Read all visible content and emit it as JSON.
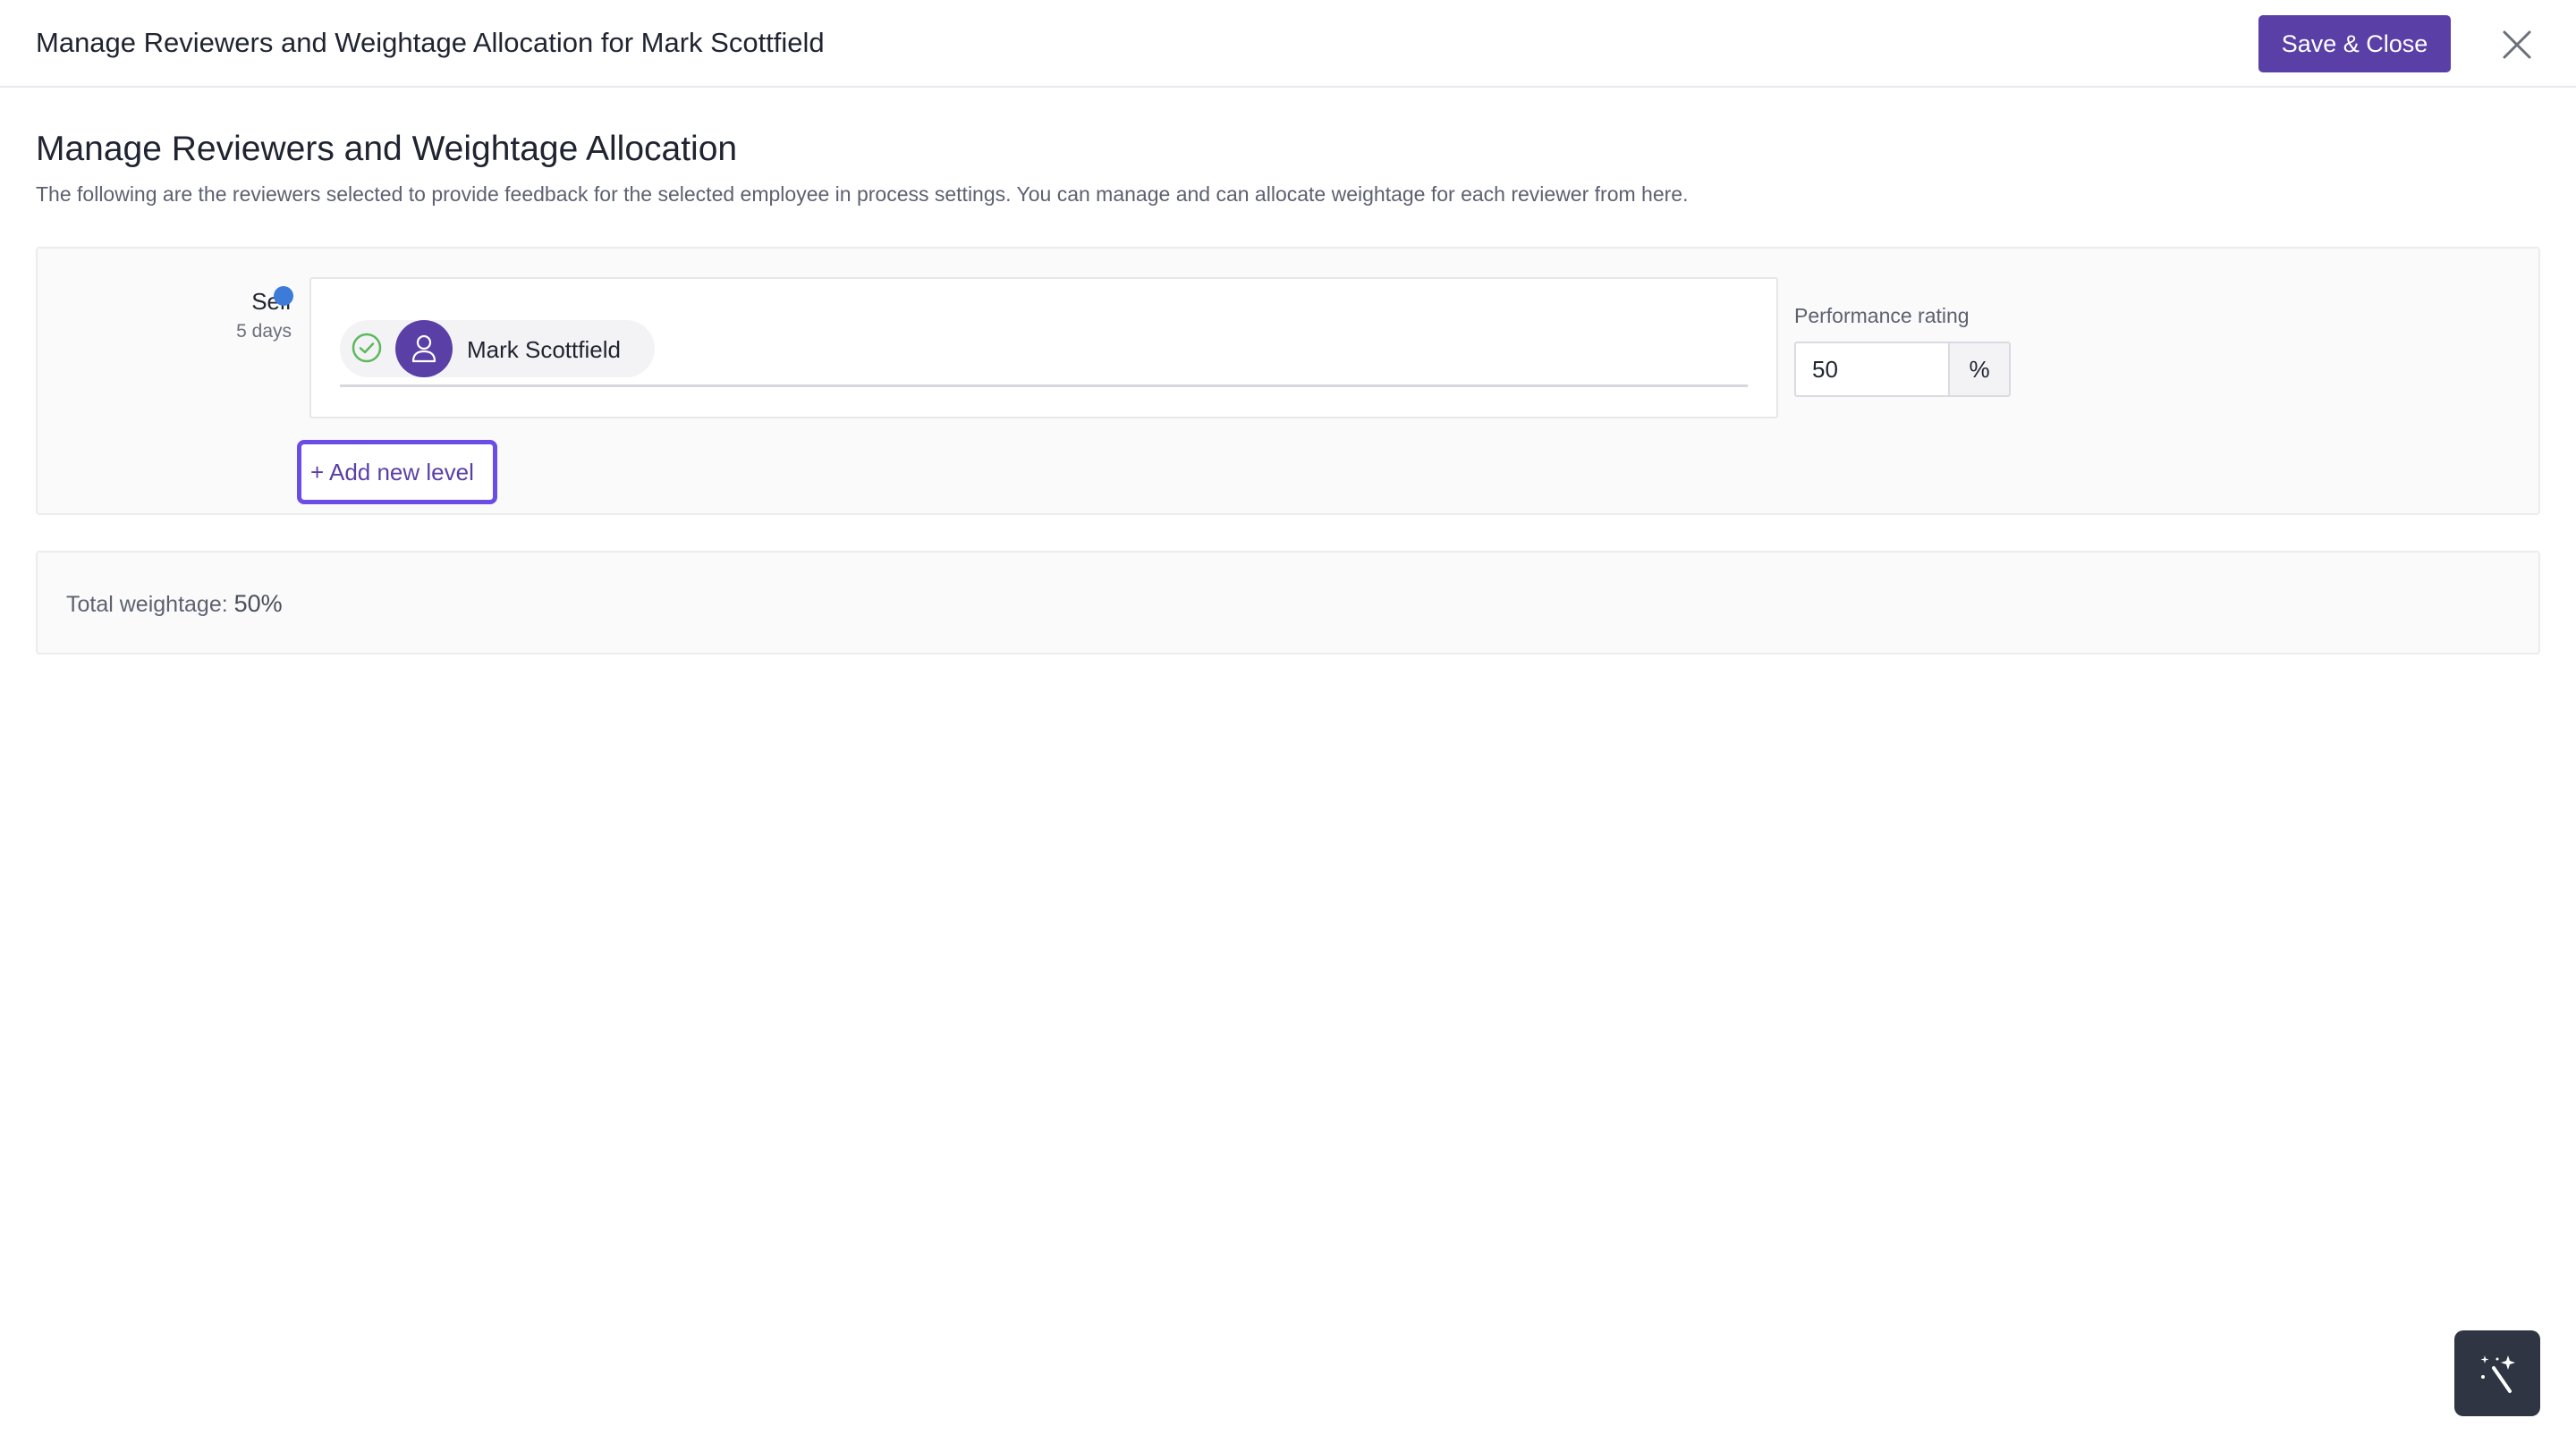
{
  "header": {
    "title": "Manage Reviewers and Weightage Allocation for Mark Scottfield",
    "save_close_label": "Save & Close"
  },
  "intro": {
    "heading": "Manage Reviewers and Weightage Allocation",
    "description": "The following are the reviewers selected to provide feedback for the selected employee in process settings. You can manage and can allocate weightage for each reviewer from here."
  },
  "level": {
    "label": "Self",
    "duration": "5 days",
    "reviewers": [
      {
        "name": "Mark Scottfield",
        "status": "confirmed"
      }
    ],
    "rating": {
      "label": "Performance rating",
      "value": "50",
      "suffix": "%"
    },
    "add_level_label": "+ Add new level"
  },
  "total": {
    "label": "Total weightage:",
    "value": "50%"
  },
  "colors": {
    "primary": "#5a3fa6",
    "focus_outline": "#6b4ce6",
    "level_dot": "#3d7bd8",
    "check": "#5cb85c",
    "assist_bg": "#2f3542"
  },
  "icons": {
    "close": "close-icon",
    "check": "check-circle-icon",
    "avatar": "user-icon",
    "assist": "magic-wand-icon"
  }
}
